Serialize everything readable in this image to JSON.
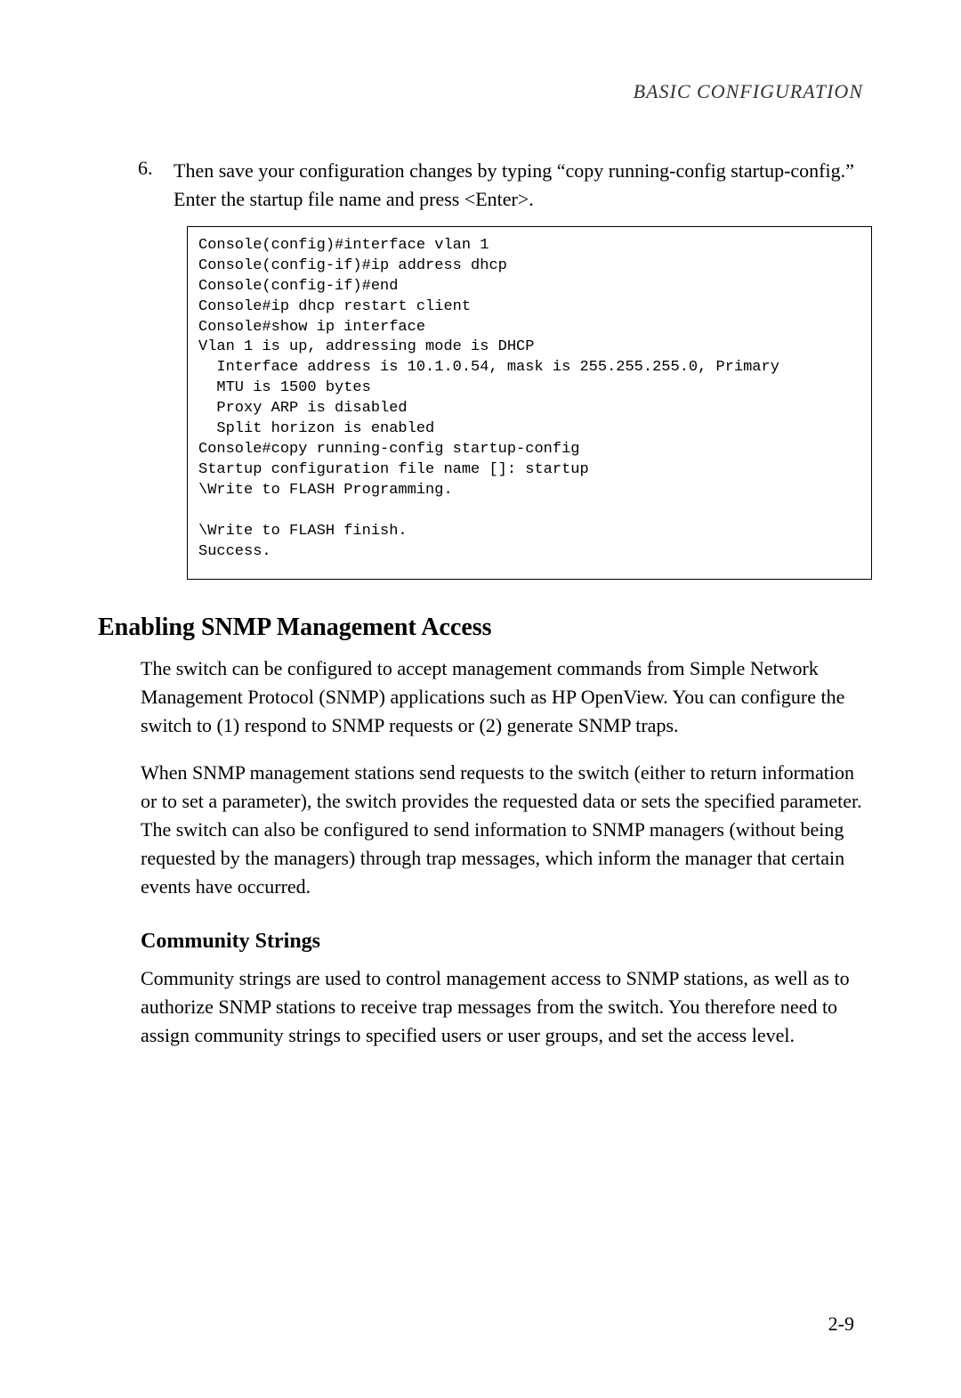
{
  "header": {
    "title": "BASIC CONFIGURATION"
  },
  "step": {
    "number": "6.",
    "text": "Then save your configuration changes by typing “copy running-config startup-config.” Enter the startup file name and press <Enter>."
  },
  "console_output": "Console(config)#interface vlan 1\nConsole(config-if)#ip address dhcp\nConsole(config-if)#end\nConsole#ip dhcp restart client\nConsole#show ip interface\nVlan 1 is up, addressing mode is DHCP\n  Interface address is 10.1.0.54, mask is 255.255.255.0, Primary\n  MTU is 1500 bytes\n  Proxy ARP is disabled\n  Split horizon is enabled\nConsole#copy running-config startup-config\nStartup configuration file name []: startup\n\\Write to FLASH Programming.\n\n\\Write to FLASH finish.\nSuccess.",
  "section": {
    "heading": "Enabling SNMP Management Access",
    "para1": "The switch can be configured to accept management commands from Simple Network Management Protocol (SNMP) applications such as HP OpenView. You can configure the switch to (1) respond to SNMP requests or (2) generate SNMP traps.",
    "para2": "When SNMP management stations send requests to the switch (either to return information or to set a parameter), the switch provides the requested data or sets the specified parameter. The switch can also be configured to send information to SNMP managers (without being requested by the managers) through trap messages, which inform the manager that certain events have occurred."
  },
  "subsection": {
    "heading": "Community Strings",
    "para": "Community strings are used to control management access to SNMP stations, as well as to authorize SNMP stations to receive trap messages from the switch. You therefore need to assign community strings to specified users or user groups, and set the access level."
  },
  "page_number": "2-9"
}
